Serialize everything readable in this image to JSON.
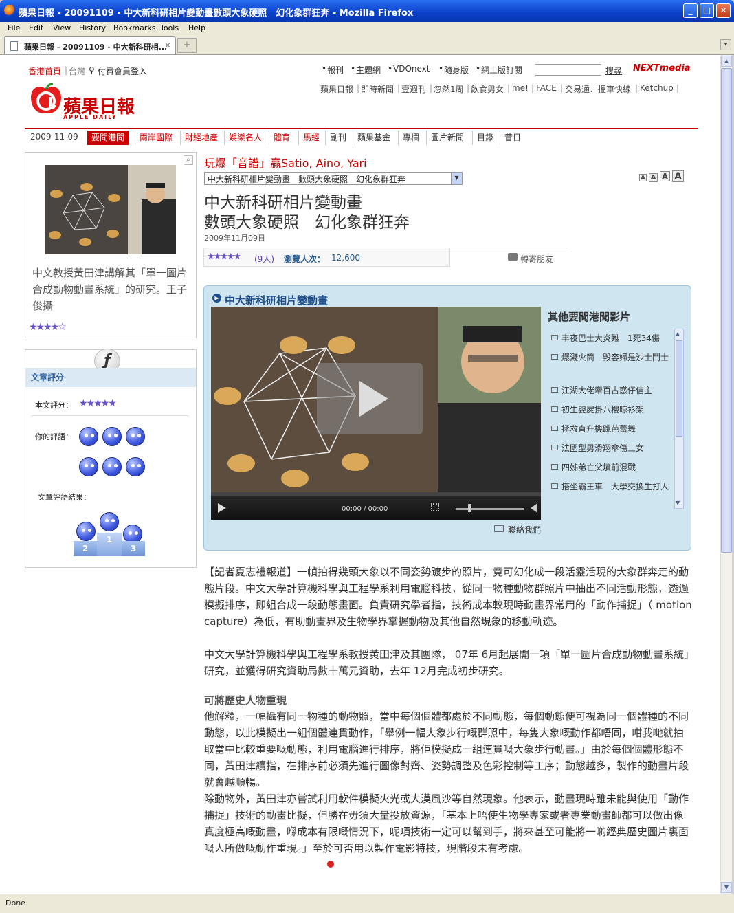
{
  "window": {
    "title": "蘋果日報 - 20091109 - 中大新科研相片變動畫數頭大象硬照　幻化象群狂奔 - Mozilla Firefox",
    "min": "_",
    "max": "□",
    "close": "✕"
  },
  "menu": [
    "File",
    "Edit",
    "View",
    "History",
    "Bookmarks",
    "Tools",
    "Help"
  ],
  "tab": {
    "label": "蘋果日報 - 20091109 - 中大新科研相...",
    "close": "✕",
    "new": "+",
    "dropdown": "▾"
  },
  "status": "Done",
  "site": {
    "region_hk": "香港首頁",
    "region_tw": "台灣",
    "member_login": "付費會員登入",
    "top_links": [
      "報刊",
      "主題網",
      "VDOnext",
      "隨身版",
      "網上版訂閱"
    ],
    "search_button": "搜尋",
    "nextmedia": "NEXTmedia",
    "logo_text": "蘋果日報",
    "logo_sub": "APPLE DAILY",
    "brand_links": [
      "蘋果日報",
      "即時新聞",
      "壹週刊",
      "忽然1周",
      "飲食男女",
      "me!",
      "FACE",
      "交易通．搵車快線",
      "Ketchup"
    ]
  },
  "nav": {
    "date": "2009-11-09",
    "items": [
      "要聞港聞",
      "兩岸國際",
      "財經地產",
      "娛樂名人",
      "體育",
      "馬經",
      "副刊",
      "蘋果基金",
      "專欄",
      "圖片新聞",
      "目錄",
      "昔日"
    ]
  },
  "side": {
    "caption": "中文教授黃田津講解其「單一圖片合成動物動畫系統」的研究。王子俊攝",
    "rating_stars": "★★★★☆",
    "rating_head": "文章評分",
    "article_score_label": "本文評分：",
    "article_score_stars": "★★★★★",
    "your_comment_label": "你的評語：",
    "result_label": "文章評語結果：",
    "podium": [
      "2",
      "1",
      "3"
    ]
  },
  "article": {
    "promo": "玩爆「音譜」贏Satio, Aino, Yari",
    "select_value": "中大新科研相片變動畫　數頭大象硬照　幻化象群狂奔",
    "font_sizes": [
      "A",
      "A",
      "A",
      "A"
    ],
    "headline_1": "中大新科研相片變動畫",
    "headline_2": "數頭大象硬照　幻化象群狂奔",
    "date": "2009年11月09日",
    "stars": "★★★★★",
    "votes": "(9人)",
    "views_label": "瀏覽人次：",
    "views": "12,600",
    "forward": "轉寄朋友",
    "video_title": "中大新科研相片變動畫",
    "video_time": "00:00 / 00:00",
    "contact": "聯絡我們",
    "others_title": "其他要聞港聞影片",
    "others": [
      "丰夜巴士大炎難　1死34傷",
      "爆濺火筒　毀容婦是沙士鬥士",
      "江湖大佬牽百古惑仔信主",
      "初生嬰屍掛八樓晾衫架",
      "拯救直升機跳芭蕾舞",
      "法國型男滑翔傘傷三女",
      "四姊弟亡父墳前混戰",
      "搭坐霸王車　大學交換生打人"
    ],
    "para1": "【記者夏志禮報道】一幀拍得幾頭大象以不同姿勢踱步的照片，竟可幻化成一段活靈活現的大象群奔走的動態片段。中文大學計算機科學與工程學系利用電腦科技，從同一物種動物群照片中抽出不同活動形態，透過模擬排序，即組合成一段動態畫面。負責研究學者指，技術成本較現時動畫界常用的「動作捕捉」（ motion capture）為低，有助動畫界及生物學界掌握動物及其他自然現象的移動軌迹。",
    "para2": "中文大學計算機科學與工程學系教授黃田津及其團隊， 07年 6月起展開一項「單一圖片合成動物動畫系統」研究，並獲得研究資助局數十萬元資助，去年 12月完成初步研究。",
    "subhead": "可將歷史人物重現",
    "para3": " 他解釋，一幅攝有同一物種的動物照，當中每個個體都處於不同動態，每個動態便可視為同一個體種的不同動態，以此模擬出一組個體連貫動作，「舉例一幅大象步行嘅群照中，每隻大象嘅動作都唔同，咁我哋就抽取當中比較重要嘅動態，利用電腦進行排序，將佢模擬成一組連貫嘅大象步行動畫。」由於每個個體形態不同，黃田津續指，在排序前必須先進行圖像對齊、姿勢調整及色彩控制等工序；動態越多，製作的動畫片段就會越順暢。",
    "para4": "除動物外，黃田津亦嘗試利用軟件模擬火光或大漠風沙等自然現象。他表示，動畫現時雖未能與使用「動作捕捉」技術的動畫比擬，但勝在毋須大量投放資源，「基本上唔使生物學專家或者專業動畫師都可以做出像真度極高嘅動畫，喺成本有限嘅情況下，呢項技術一定可以幫到手，將來甚至可能將一啲經典歷史圖片裏面嘅人所做嘅動作重現。」至於可否用以製作電影特技，現階段未有考慮。"
  }
}
